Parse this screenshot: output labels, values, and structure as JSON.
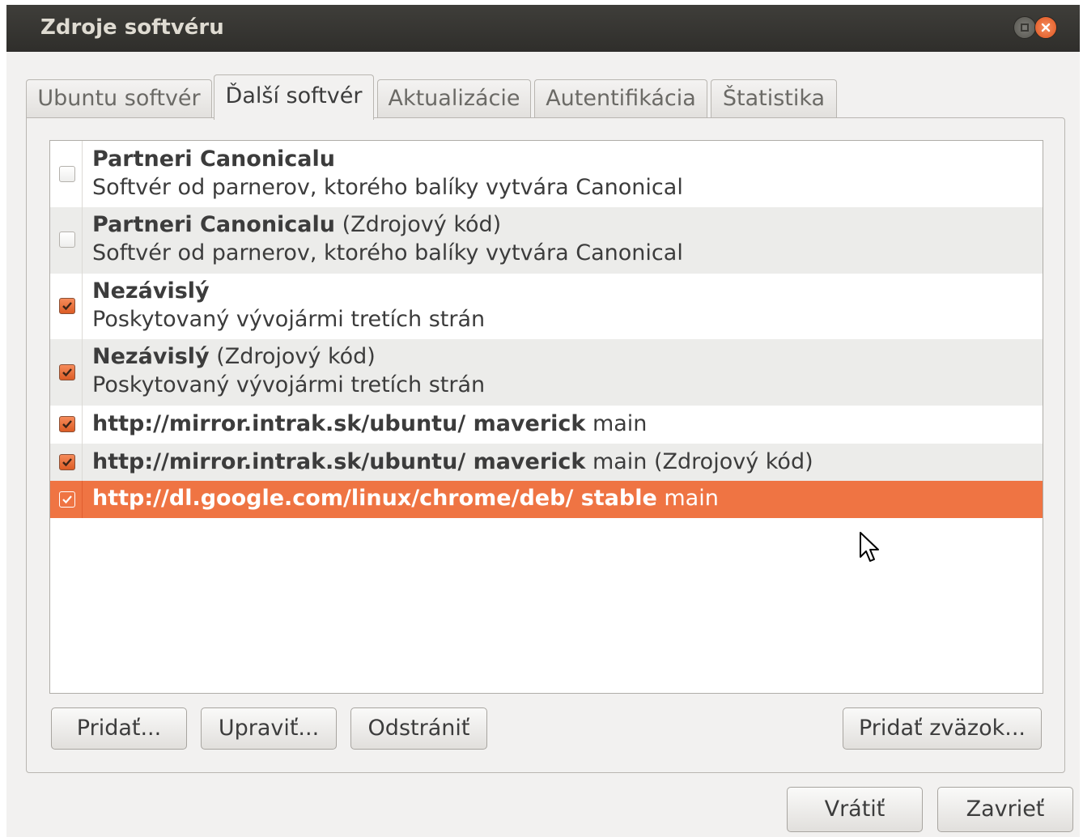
{
  "window": {
    "title": "Zdroje softvéru",
    "accent_color": "#ef7443"
  },
  "tabs": [
    {
      "label": "Ubuntu softvér"
    },
    {
      "label": "Ďalší softvér"
    },
    {
      "label": "Aktualizácie"
    },
    {
      "label": "Autentifikácia"
    },
    {
      "label": "Štatistika"
    }
  ],
  "active_tab": "Ďalší softvér",
  "sources": [
    {
      "title": "Partneri Canonicalu",
      "suffix": "",
      "description": "Softvér od parnerov, ktorého balíky vytvára Canonical",
      "checked": false
    },
    {
      "title": "Partneri Canonicalu",
      "suffix": " (Zdrojový kód)",
      "description": "Softvér od parnerov, ktorého balíky vytvára Canonical",
      "checked": false
    },
    {
      "title": "Nezávislý",
      "suffix": "",
      "description": "Poskytovaný vývojármi tretích strán",
      "checked": true
    },
    {
      "title": "Nezávislý",
      "suffix": " (Zdrojový kód)",
      "description": "Poskytovaný vývojármi tretích strán",
      "checked": true
    },
    {
      "title": "http://mirror.intrak.sk/ubuntu/ maverick",
      "suffix": " main",
      "checked": true
    },
    {
      "title": "http://mirror.intrak.sk/ubuntu/ maverick",
      "suffix": " main (Zdrojový kód)",
      "checked": true
    },
    {
      "title": "http://dl.google.com/linux/chrome/deb/ stable",
      "suffix": " main",
      "checked": true,
      "selected": true
    }
  ],
  "buttons": {
    "add": "Pridať...",
    "edit": "Upraviť...",
    "remove": "Odstrániť",
    "add_cd": "Pridať zväzok...",
    "revert": "Vrátiť",
    "close": "Zavrieť"
  }
}
